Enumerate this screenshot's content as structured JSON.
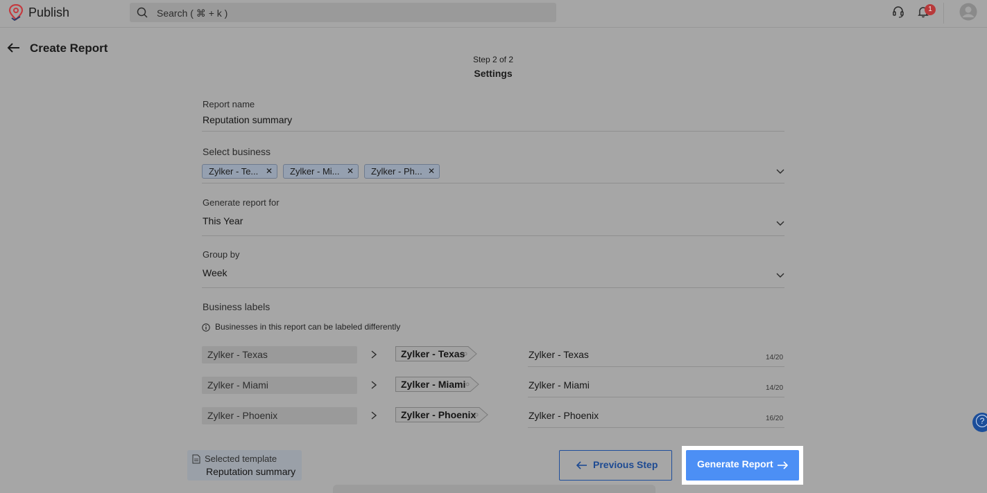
{
  "header": {
    "app_name": "Publish",
    "search_placeholder": "Search ( ⌘ + k )",
    "notification_count": "1"
  },
  "page": {
    "title": "Create Report",
    "step": "Step 2 of 2",
    "step_name": "Settings"
  },
  "form": {
    "report_name_label": "Report name",
    "report_name_value": "Reputation summary",
    "select_business_label": "Select business",
    "selected_businesses": [
      "Zylker - Te...",
      "Zylker - Mi...",
      "Zylker - Ph..."
    ],
    "generate_for_label": "Generate report for",
    "generate_for_value": "This Year",
    "group_by_label": "Group by",
    "group_by_value": "Week",
    "business_labels_title": "Business labels",
    "business_labels_info": "Businesses in this report can be labeled differently",
    "label_rows": [
      {
        "original": "Zylker - Texas",
        "tag": "Zylker - Texas",
        "label": "Zylker - Texas",
        "counter": "14/20"
      },
      {
        "original": "Zylker - Miami",
        "tag": "Zylker - Miami",
        "label": "Zylker - Miami",
        "counter": "14/20"
      },
      {
        "original": "Zylker - Phoenix",
        "tag": "Zylker - Phoenix",
        "label": "Zylker - Phoenix",
        "counter": "16/20"
      }
    ]
  },
  "footer": {
    "template_caption": "Selected template",
    "template_name": "Reputation summary",
    "previous_label": "Previous Step",
    "generate_label": "Generate Report"
  },
  "colors": {
    "primary": "#4c8ff5",
    "link": "#1d4a92",
    "badge": "#b8393a",
    "brand_logo": "#e5484d"
  },
  "icons": [
    "logo-icon",
    "search-icon",
    "headset-icon",
    "bell-icon",
    "avatar-icon",
    "back-arrow-icon",
    "chevron-down-icon",
    "close-icon",
    "info-icon",
    "chevron-right-icon",
    "tag-icon",
    "help-icon",
    "document-icon",
    "arrow-left-icon",
    "arrow-right-icon"
  ]
}
